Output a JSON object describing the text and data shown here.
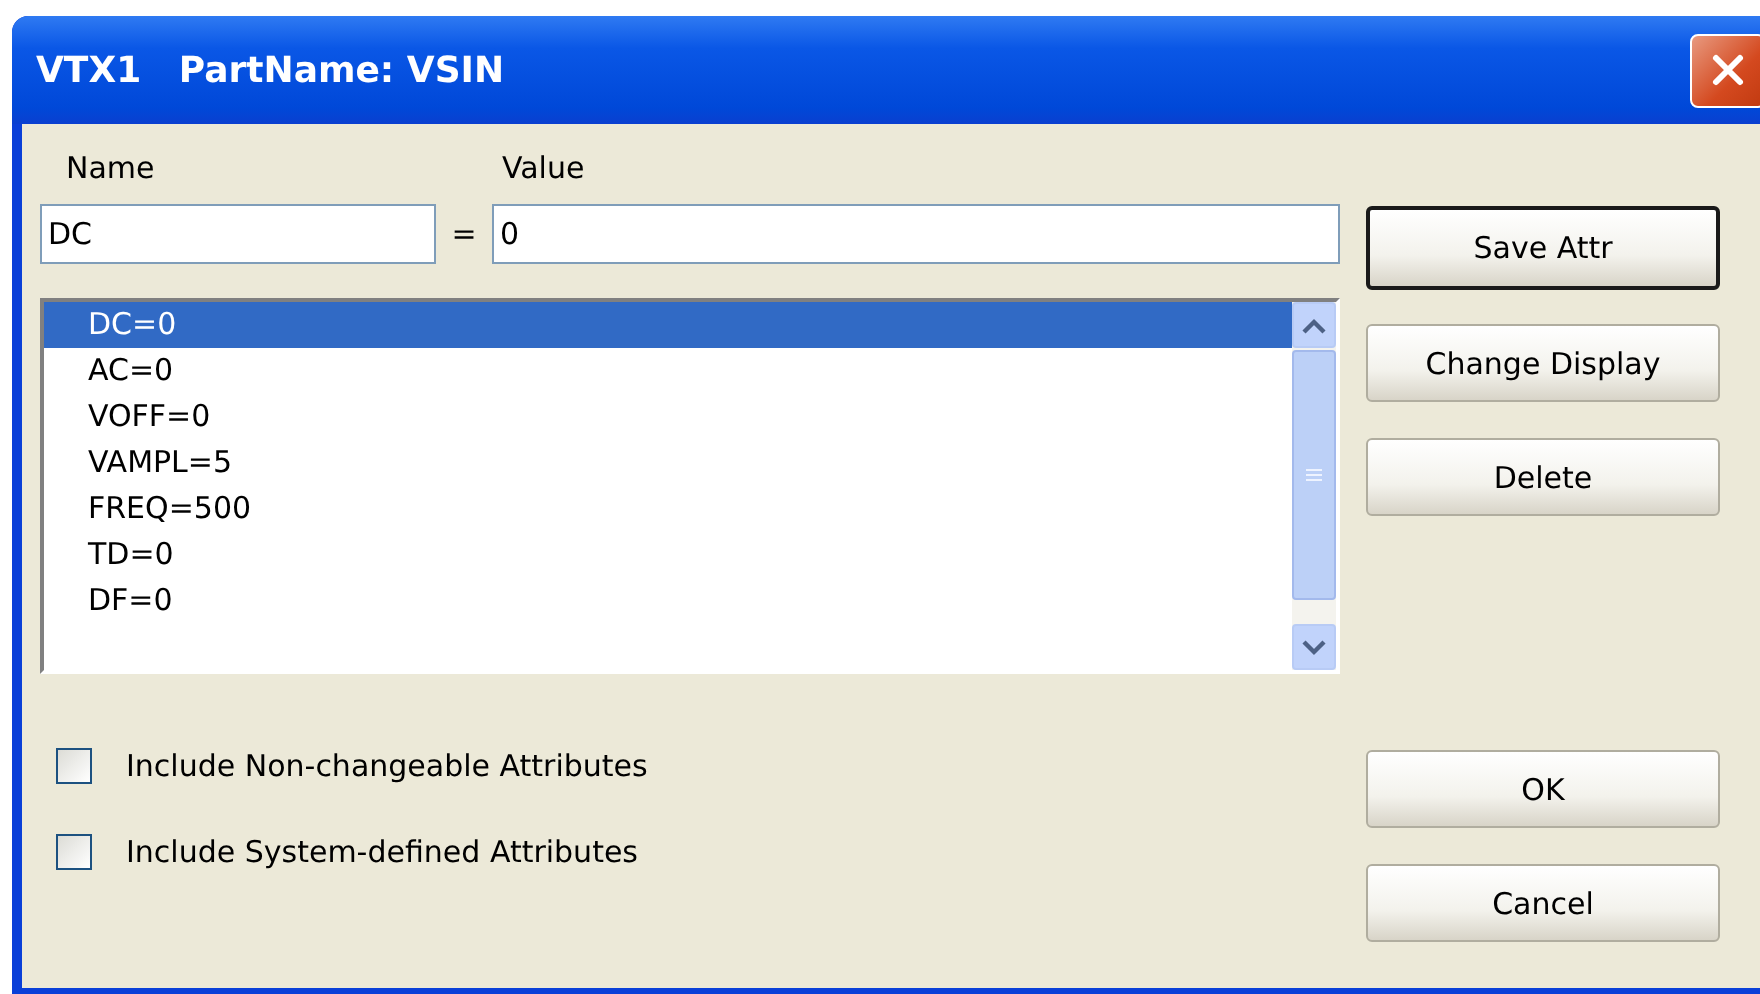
{
  "window": {
    "title": "VTX1   PartName: VSIN"
  },
  "name_field": {
    "label": "Name",
    "value": "DC"
  },
  "equals": "=",
  "value_field": {
    "label": "Value",
    "value": "0"
  },
  "attributes": [
    {
      "text": "DC=0",
      "selected": true
    },
    {
      "text": "AC=0",
      "selected": false
    },
    {
      "text": "VOFF=0",
      "selected": false
    },
    {
      "text": "VAMPL=5",
      "selected": false
    },
    {
      "text": "FREQ=500",
      "selected": false
    },
    {
      "text": "TD=0",
      "selected": false
    },
    {
      "text": "DF=0",
      "selected": false
    }
  ],
  "checkboxes": [
    {
      "label": "Include Non-changeable Attributes",
      "checked": false
    },
    {
      "label": "Include System-defined Attributes",
      "checked": false
    }
  ],
  "buttons": [
    {
      "label": "Save Attr",
      "default": true
    },
    {
      "label": "Change Display",
      "default": false
    },
    {
      "label": "Delete",
      "default": false
    },
    {
      "label": "OK",
      "default": false
    },
    {
      "label": "Cancel",
      "default": false
    }
  ]
}
